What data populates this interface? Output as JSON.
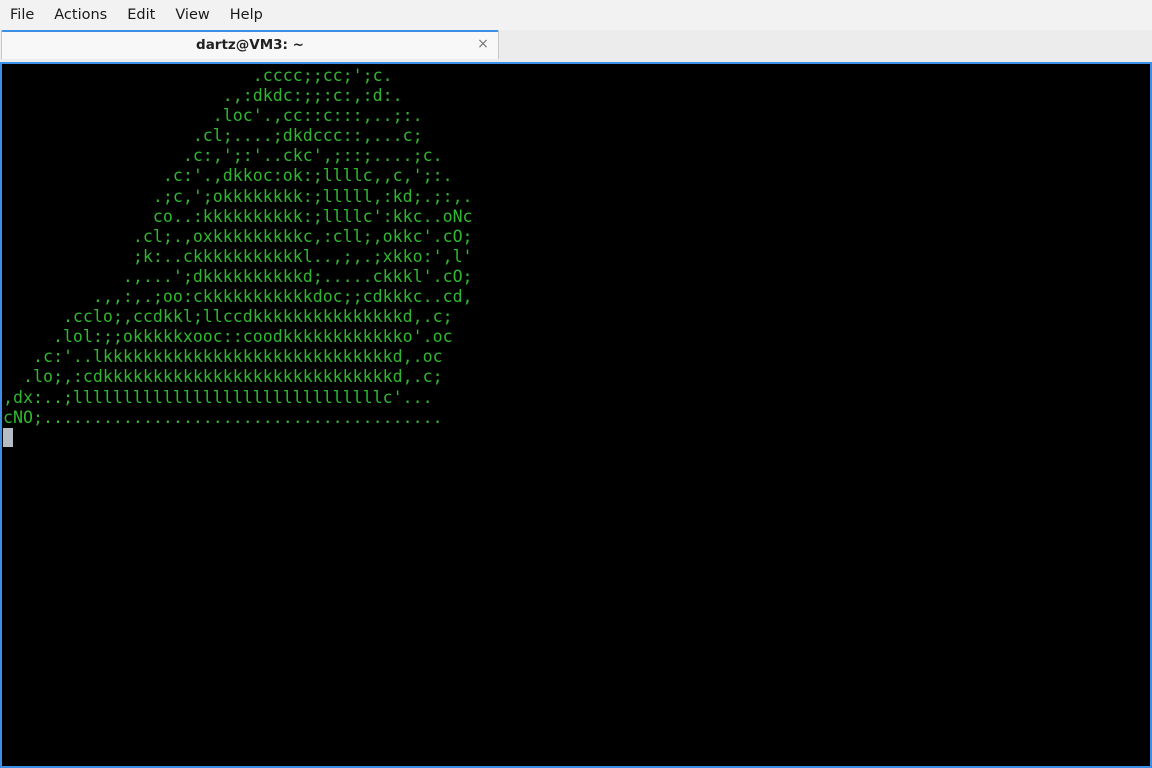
{
  "menubar": {
    "items": [
      "File",
      "Actions",
      "Edit",
      "View",
      "Help"
    ]
  },
  "tabs": [
    {
      "title": "dartz@VM3: ~",
      "close_glyph": "×"
    }
  ],
  "terminal": {
    "colors": {
      "background": "#000000",
      "foreground": "#2fb82f",
      "accent": "#3d8ee6"
    },
    "lines": [
      "                         .cccc;;cc;';c.",
      "                      .,:dkdc:;;:c:,:d:.",
      "                     .loc'.,cc::c:::,..;:.",
      "                   .cl;....;dkdccc::,...c;",
      "                  .c:,';:'..ckc',;::;....;c.",
      "                .c:'.,dkkoc:ok:;llllc,,c,';:.",
      "               .;c,';okkkkkkkk:;lllll,:kd;.;:,.",
      "               co..:kkkkkkkkkk:;llllc':kkc..oNc",
      "             .cl;.,oxkkkkkkkkkc,:cll;,okkc'.cO;",
      "             ;k:..ckkkkkkkkkkkl..,;,.;xkko:',l'",
      "            .,...';dkkkkkkkkkkd;.....ckkkl'.cO;",
      "         .,,:,.;oo:ckkkkkkkkkkkdoc;;cdkkkc..cd,",
      "      .cclo;,ccdkkl;llccdkkkkkkkkkkkkkkkd,.c;",
      "     .lol:;;okkkkkxooc::coodkkkkkkkkkkkko'.oc",
      "   .c:'..lkkkkkkkkkkkkkkkkkkkkkkkkkkkkkd,.oc",
      "  .lo;,:cdkkkkkkkkkkkkkkkkkkkkkkkkkkkkkd,.c;",
      ",dx:..;lllllllllllllllllllllllllllllllc'...",
      "cNO;........................................"
    ]
  }
}
